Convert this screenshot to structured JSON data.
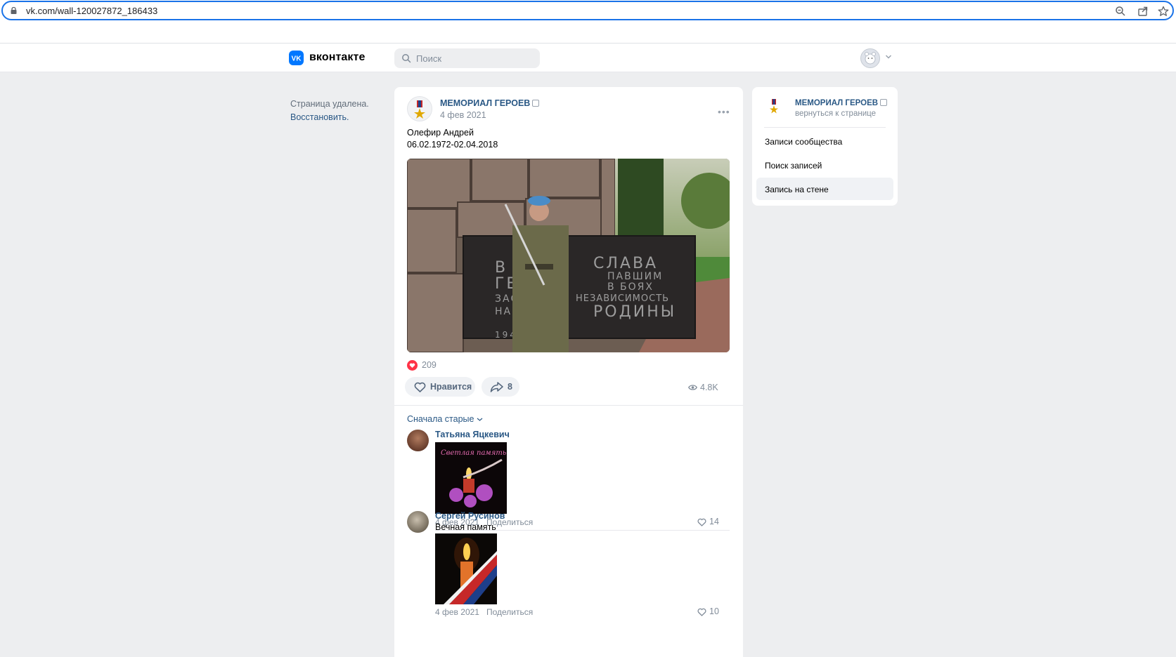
{
  "browser": {
    "url": "vk.com/wall-120027872_186433"
  },
  "header": {
    "logo_text": "вконтакте",
    "search_placeholder": "Поиск"
  },
  "left": {
    "deleted_text": "Страница удалена.",
    "restore_label": "Восстановить."
  },
  "post": {
    "group_name": "МЕМОРИАЛ ГЕРОЕВ",
    "date": "4 фев 2021",
    "text_line1": "Олефир Андрей",
    "text_line2": "06.02.1972-02.04.2018",
    "photo_inscription_left1": "В",
    "photo_inscription_left2": "ГЕН",
    "photo_inscription_left3": "ЗАСВ",
    "photo_inscription_left4": "НАШ",
    "photo_inscription_year": "1941",
    "photo_inscription_right1": "СЛАВА",
    "photo_inscription_right2": "ПАВШИМ",
    "photo_inscription_right3": "В БОЯХ",
    "photo_inscription_right4": "НЕЗАВИСИМОСТЬ",
    "photo_inscription_right5": "РОДИНЫ",
    "reactions_count": "209",
    "like_label": "Нравится",
    "share_count": "8",
    "views": "4.8K",
    "sort_label": "Сначала старые"
  },
  "comments": [
    {
      "author": "Татьяна Яцкевич",
      "text": "",
      "image_caption": "Светлая память....",
      "date": "4 фев 2021",
      "share_label": "Поделиться",
      "likes": "14"
    },
    {
      "author": "Сергей Русинов",
      "text": "Вечная память",
      "date": "4 фев 2021",
      "share_label": "Поделиться",
      "likes": "10"
    }
  ],
  "right_menu": {
    "group_name": "МЕМОРИАЛ ГЕРОЕВ",
    "back_label": "вернуться к странице",
    "items": [
      {
        "label": "Записи сообщества"
      },
      {
        "label": "Поиск записей"
      },
      {
        "label": "Запись на стене"
      }
    ]
  },
  "colors": {
    "vk_blue": "#0077ff",
    "link": "#2a5885",
    "background": "#edeef0",
    "like_red": "#ff3347"
  }
}
